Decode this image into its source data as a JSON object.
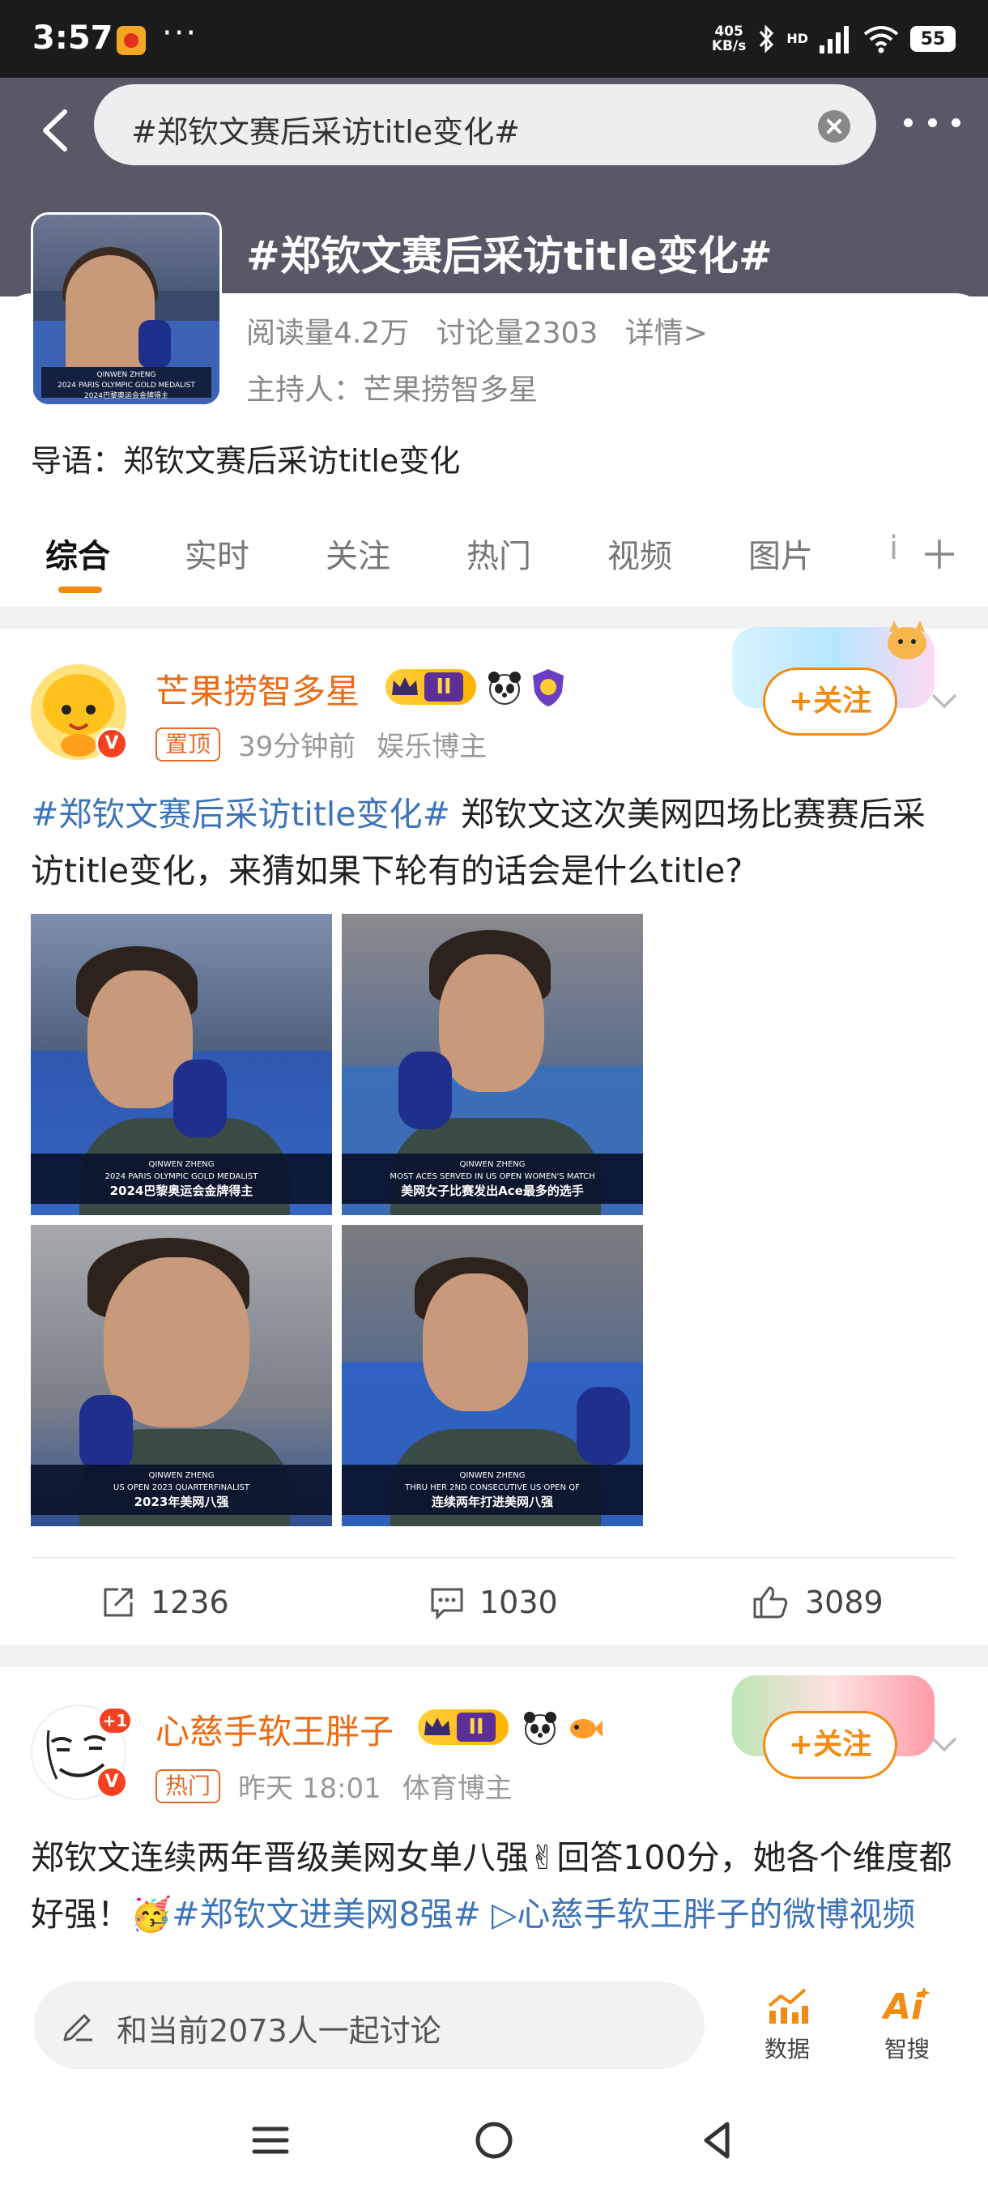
{
  "status_bar": {
    "time": "3:57",
    "dots": "···",
    "net_speed_value": "405",
    "net_speed_unit": "KB/s",
    "bt": "ꔪ",
    "signal_label": "HD",
    "battery": "55"
  },
  "search": {
    "query": "#郑钦文赛后采访title变化#"
  },
  "topic": {
    "title": "#郑钦文赛后采访title变化#",
    "reads": "阅读量4.2万",
    "discussions": "讨论量2303",
    "details_link": "详情>",
    "host": "主持人：芒果捞智多星",
    "intro": "导语：郑钦文赛后采访title变化",
    "cover_caption_line1": "QINWEN ZHENG",
    "cover_caption_line2": "2024 PARIS OLYMPIC GOLD MEDALIST",
    "cover_caption_line3": "2024巴黎奥运会金牌得主"
  },
  "tabs": [
    {
      "label": "综合"
    },
    {
      "label": "实时"
    },
    {
      "label": "关注"
    },
    {
      "label": "热门"
    },
    {
      "label": "视频"
    },
    {
      "label": "图片"
    },
    {
      "label": "i"
    }
  ],
  "posts": [
    {
      "author": "芒果捞智多星",
      "level_badge": "II",
      "tag": "置顶",
      "time": "39分钟前",
      "role": "娱乐博主",
      "follow_label": "+关注",
      "hashtag": "#郑钦文赛后采访title变化#",
      "text": " 郑钦文这次美网四场比赛赛后采访title变化，来猜如果下轮有的话会是什么title?",
      "photos": [
        {
          "name_line": "QINWEN ZHENG",
          "en_line": "2024 PARIS OLYMPIC GOLD MEDALIST",
          "zh_line": "2024巴黎奥运会金牌得主"
        },
        {
          "name_line": "QINWEN ZHENG",
          "en_line": "MOST ACES SERVED IN US OPEN WOMEN'S MATCH",
          "zh_line": "美网女子比赛发出Ace最多的选手"
        },
        {
          "name_line": "QINWEN ZHENG",
          "en_line": "US OPEN 2023 QUARTERFINALIST",
          "zh_line": "2023年美网八强"
        },
        {
          "name_line": "QINWEN ZHENG",
          "en_line": "THRU HER 2ND CONSECUTIVE US OPEN QF",
          "zh_line": "连续两年打进美网八强"
        }
      ],
      "shares": "1236",
      "comments": "1030",
      "likes": "3089"
    },
    {
      "author": "心慈手软王胖子",
      "level_badge": "II",
      "tag": "热门",
      "time": "昨天 18:01",
      "role": "体育博主",
      "follow_label": "+关注",
      "avatar_badge": "+1",
      "text": "郑钦文连续两年晋级美网女单八强✌回答100分，她各个维度都好强！🥳",
      "hashtag": "#郑钦文进美网8强#",
      "video_link": " ▷心慈手软王胖子的",
      "text_tail": "微博视频"
    }
  ],
  "bottom_bar": {
    "discuss_placeholder": "和当前2073人一起讨论",
    "data_label": "数据",
    "search_label": "智搜"
  },
  "colors": {
    "accent": "#f28b11",
    "hashtag": "#3d74b8",
    "header_bg": "#5a5766"
  }
}
